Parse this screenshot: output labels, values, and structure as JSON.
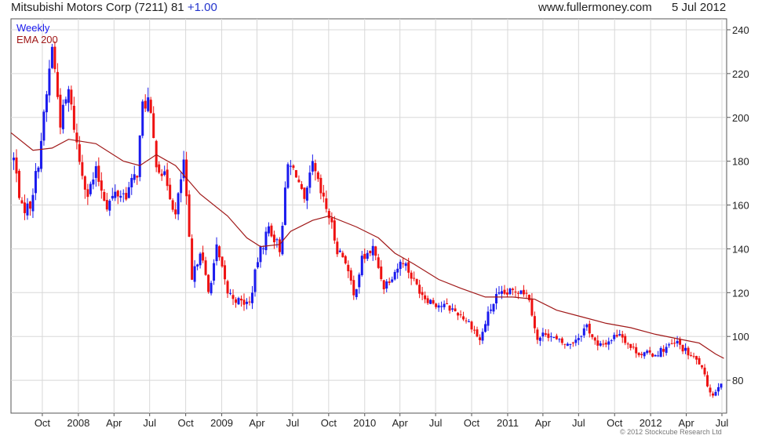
{
  "header": {
    "name": "Mitsubishi Motors Corp (7211) 81",
    "change": "+1.00",
    "site": "www.fullermoney.com",
    "date": "5 Jul 2012"
  },
  "footer": {
    "copyright": "© 2012 Stockcube Research Ltd"
  },
  "colors": {
    "up": "#1a1aee",
    "down": "#ee1111",
    "ema": "#a01818",
    "grid": "#d8d8d8",
    "axis": "#555555"
  },
  "chart_data": {
    "type": "candlestick",
    "series": [
      {
        "name": "Weekly",
        "color": "#1a1aee"
      },
      {
        "name": "EMA 200",
        "color": "#a01818"
      }
    ],
    "ylim": [
      65,
      245
    ],
    "y_ticks": [
      80,
      100,
      120,
      140,
      160,
      180,
      200,
      220,
      240
    ],
    "x_range": [
      "2007-07-13",
      "2012-07-13"
    ],
    "x_ticks": [
      {
        "label": "Oct",
        "date": "2007-10-01"
      },
      {
        "label": "2008",
        "date": "2008-01-01"
      },
      {
        "label": "Apr",
        "date": "2008-04-01"
      },
      {
        "label": "Jul",
        "date": "2008-07-01"
      },
      {
        "label": "Oct",
        "date": "2008-10-01"
      },
      {
        "label": "2009",
        "date": "2009-01-01"
      },
      {
        "label": "Apr",
        "date": "2009-04-01"
      },
      {
        "label": "Jul",
        "date": "2009-07-01"
      },
      {
        "label": "Oct",
        "date": "2009-10-01"
      },
      {
        "label": "2010",
        "date": "2010-01-01"
      },
      {
        "label": "Apr",
        "date": "2010-04-01"
      },
      {
        "label": "Jul",
        "date": "2010-07-01"
      },
      {
        "label": "Oct",
        "date": "2010-10-01"
      },
      {
        "label": "2011",
        "date": "2011-01-01"
      },
      {
        "label": "Apr",
        "date": "2011-04-01"
      },
      {
        "label": "Jul",
        "date": "2011-07-01"
      },
      {
        "label": "Oct",
        "date": "2011-10-01"
      },
      {
        "label": "2012",
        "date": "2012-01-01"
      },
      {
        "label": "Apr",
        "date": "2012-04-01"
      },
      {
        "label": "Jul",
        "date": "2012-07-01"
      }
    ],
    "close_path": [
      [
        "2007-07-20",
        181
      ],
      [
        "2007-08-10",
        158
      ],
      [
        "2007-08-31",
        160
      ],
      [
        "2007-09-21",
        180
      ],
      [
        "2007-10-12",
        210
      ],
      [
        "2007-10-26",
        233
      ],
      [
        "2007-11-16",
        198
      ],
      [
        "2007-12-07",
        212
      ],
      [
        "2008-01-04",
        180
      ],
      [
        "2008-01-25",
        165
      ],
      [
        "2008-02-15",
        175
      ],
      [
        "2008-03-14",
        160
      ],
      [
        "2008-04-04",
        165
      ],
      [
        "2008-05-02",
        165
      ],
      [
        "2008-05-30",
        175
      ],
      [
        "2008-06-13",
        205
      ],
      [
        "2008-06-27",
        208
      ],
      [
        "2008-07-18",
        180
      ],
      [
        "2008-08-15",
        170
      ],
      [
        "2008-09-05",
        155
      ],
      [
        "2008-09-26",
        180
      ],
      [
        "2008-10-17",
        125
      ],
      [
        "2008-11-07",
        140
      ],
      [
        "2008-11-28",
        120
      ],
      [
        "2008-12-19",
        140
      ],
      [
        "2009-01-16",
        120
      ],
      [
        "2009-02-13",
        116
      ],
      [
        "2009-03-13",
        115
      ],
      [
        "2009-04-03",
        135
      ],
      [
        "2009-05-01",
        150
      ],
      [
        "2009-05-29",
        140
      ],
      [
        "2009-06-19",
        178
      ],
      [
        "2009-07-10",
        175
      ],
      [
        "2009-07-31",
        160
      ],
      [
        "2009-08-21",
        178
      ],
      [
        "2009-09-11",
        165
      ],
      [
        "2009-10-02",
        155
      ],
      [
        "2009-10-23",
        140
      ],
      [
        "2009-11-13",
        135
      ],
      [
        "2009-12-04",
        118
      ],
      [
        "2009-12-25",
        135
      ],
      [
        "2010-01-22",
        140
      ],
      [
        "2010-02-19",
        123
      ],
      [
        "2010-03-19",
        130
      ],
      [
        "2010-04-09",
        135
      ],
      [
        "2010-05-07",
        125
      ],
      [
        "2010-06-04",
        118
      ],
      [
        "2010-07-02",
        115
      ],
      [
        "2010-08-06",
        113
      ],
      [
        "2010-09-03",
        110
      ],
      [
        "2010-10-01",
        105
      ],
      [
        "2010-10-22",
        98
      ],
      [
        "2010-11-12",
        110
      ],
      [
        "2010-12-03",
        118
      ],
      [
        "2011-01-07",
        120
      ],
      [
        "2011-02-04",
        122
      ],
      [
        "2011-02-25",
        118
      ],
      [
        "2011-03-18",
        98
      ],
      [
        "2011-04-08",
        102
      ],
      [
        "2011-05-06",
        98
      ],
      [
        "2011-06-03",
        96
      ],
      [
        "2011-07-01",
        100
      ],
      [
        "2011-07-22",
        105
      ],
      [
        "2011-08-19",
        95
      ],
      [
        "2011-09-16",
        98
      ],
      [
        "2011-10-14",
        102
      ],
      [
        "2011-11-11",
        95
      ],
      [
        "2011-12-09",
        92
      ],
      [
        "2012-01-13",
        92
      ],
      [
        "2012-02-10",
        95
      ],
      [
        "2012-03-09",
        97
      ],
      [
        "2012-04-06",
        92
      ],
      [
        "2012-05-04",
        88
      ],
      [
        "2012-05-25",
        78
      ],
      [
        "2012-06-08",
        73
      ],
      [
        "2012-06-22",
        78
      ],
      [
        "2012-07-05",
        81
      ]
    ],
    "ema_path": [
      [
        "2007-07-13",
        193
      ],
      [
        "2007-09-07",
        185
      ],
      [
        "2007-10-26",
        186
      ],
      [
        "2007-12-07",
        190
      ],
      [
        "2008-02-15",
        188
      ],
      [
        "2008-04-25",
        180
      ],
      [
        "2008-06-06",
        178
      ],
      [
        "2008-07-18",
        183
      ],
      [
        "2008-09-05",
        178
      ],
      [
        "2008-11-07",
        165
      ],
      [
        "2009-01-16",
        155
      ],
      [
        "2009-03-06",
        145
      ],
      [
        "2009-04-10",
        141
      ],
      [
        "2009-05-29",
        142
      ],
      [
        "2009-06-26",
        148
      ],
      [
        "2009-08-21",
        153
      ],
      [
        "2009-10-02",
        155
      ],
      [
        "2009-12-11",
        150
      ],
      [
        "2010-02-05",
        145
      ],
      [
        "2010-03-19",
        138
      ],
      [
        "2010-05-07",
        133
      ],
      [
        "2010-07-09",
        126
      ],
      [
        "2010-09-03",
        122
      ],
      [
        "2010-11-05",
        118
      ],
      [
        "2011-01-14",
        118
      ],
      [
        "2011-03-11",
        117
      ],
      [
        "2011-05-06",
        112
      ],
      [
        "2011-07-08",
        109
      ],
      [
        "2011-09-09",
        106
      ],
      [
        "2011-11-11",
        104
      ],
      [
        "2012-01-13",
        101
      ],
      [
        "2012-03-09",
        99
      ],
      [
        "2012-05-04",
        97
      ],
      [
        "2012-06-15",
        92
      ],
      [
        "2012-07-06",
        90
      ]
    ]
  }
}
